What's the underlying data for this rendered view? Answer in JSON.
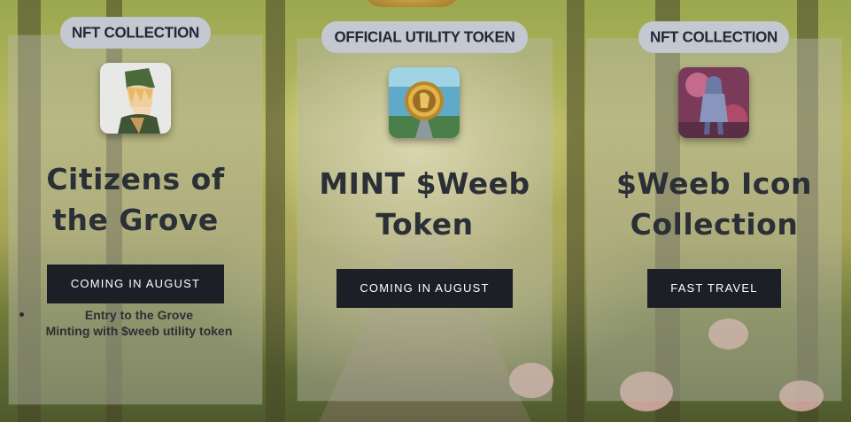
{
  "cards": [
    {
      "badge": "NFT COLLECTION",
      "title_line1": "Citizens of",
      "title_line2": "the Grove",
      "button": "COMING IN AUGUST",
      "features": [
        "Entry to the Grove",
        "Minting with $weeb utility token"
      ],
      "image": "anime-elf-character-avatar"
    },
    {
      "badge": "OFFICIAL UTILITY TOKEN",
      "title_line1": "MINT $Weeb",
      "title_line2": "Token",
      "button": "COMING IN AUGUST",
      "image": "gold-coin-artwork"
    },
    {
      "badge": "NFT COLLECTION",
      "title_line1": "$Weeb Icon",
      "title_line2": "Collection",
      "button": "FAST TRAVEL",
      "image": "hooded-figure-artwork"
    }
  ],
  "colors": {
    "badge_bg": "#c4c8d1",
    "button_bg": "#1c1f26",
    "title_text": "#2b2f36"
  }
}
